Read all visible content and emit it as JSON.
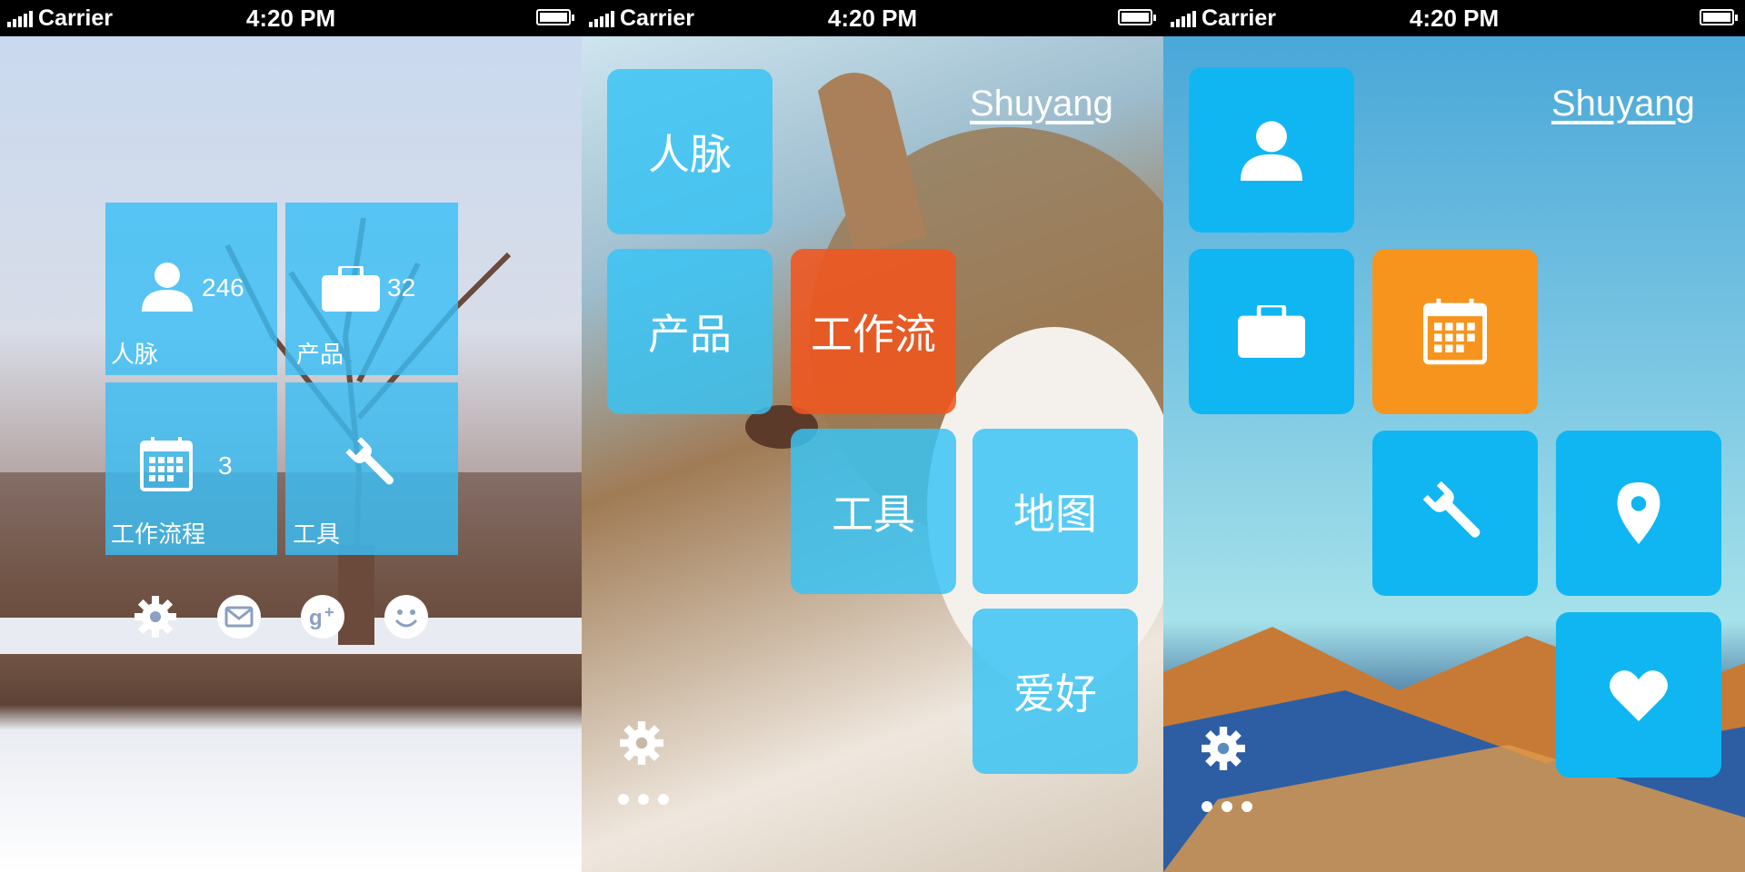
{
  "status_bar": {
    "carrier": "Carrier",
    "time": "4:20 PM"
  },
  "screen1": {
    "tiles": [
      {
        "label": "人脉",
        "count": "246",
        "icon": "user-icon"
      },
      {
        "label": "产品",
        "count": "32",
        "icon": "briefcase-icon"
      },
      {
        "label": "工作流程",
        "count": "3",
        "icon": "calendar-icon"
      },
      {
        "label": "工具",
        "count": "",
        "icon": "wrench-icon"
      }
    ],
    "bottom_icons": [
      "gear-icon",
      "mail-icon",
      "google-plus-icon",
      "smiley-icon"
    ]
  },
  "screen2": {
    "username": "Shuyang",
    "tiles": [
      {
        "label": "人脉"
      },
      {
        "label": "产品"
      },
      {
        "label": "工作流"
      },
      {
        "label": "工具"
      },
      {
        "label": "地图"
      },
      {
        "label": "爱好"
      }
    ]
  },
  "screen3": {
    "username": "Shuyang",
    "tiles": [
      {
        "icon": "user-icon"
      },
      {
        "icon": "briefcase-icon"
      },
      {
        "icon": "calendar-icon"
      },
      {
        "icon": "wrench-icon"
      },
      {
        "icon": "map-pin-icon"
      },
      {
        "icon": "heart-icon"
      }
    ]
  },
  "colors": {
    "tile_blue": "#10b6f2",
    "tile_orange": "#f7941d",
    "tile_red_orange": "#f0551e"
  }
}
